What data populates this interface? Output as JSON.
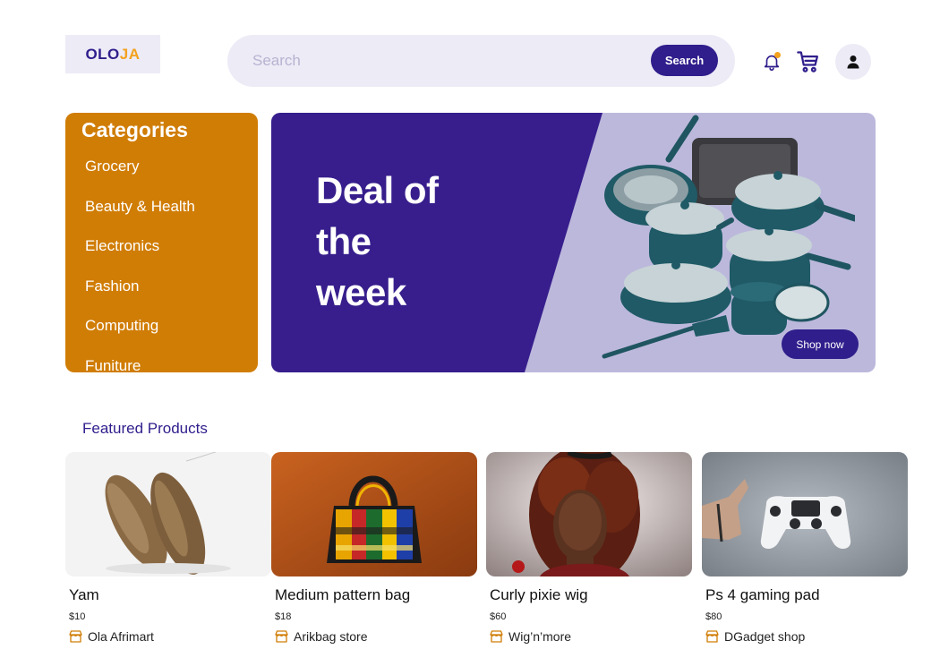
{
  "header": {
    "logo_part1": "OLO",
    "logo_part2": "JA",
    "search_placeholder": "Search",
    "search_button": "Search",
    "icons": [
      "bell-icon",
      "cart-icon",
      "user-icon"
    ]
  },
  "categories": {
    "title": "Categories",
    "items": [
      "Grocery",
      "Beauty & Health",
      "Electronics",
      "Fashion",
      "Computing",
      "Funiture"
    ]
  },
  "banner": {
    "line1": "Deal of",
    "line2": "the",
    "line3": "week",
    "button": "Shop now"
  },
  "featured": {
    "title": "Featured Products",
    "products": [
      {
        "name": "Yam",
        "price": "$10",
        "store": "Ola Afrimart"
      },
      {
        "name": "Medium pattern bag",
        "price": "$18",
        "store": "Arikbag store"
      },
      {
        "name": "Curly pixie wig",
        "price": "$60",
        "store": "Wig’n’more"
      },
      {
        "name": "Ps 4 gaming pad",
        "price": "$80",
        "store": "DGadget shop"
      }
    ]
  },
  "colors": {
    "brand_purple": "#2f1e8c",
    "accent_orange": "#f3a21f",
    "category_bg": "#d07d06",
    "banner_lilac": "#bcb8dc",
    "soft_bg": "#ecebf6"
  }
}
